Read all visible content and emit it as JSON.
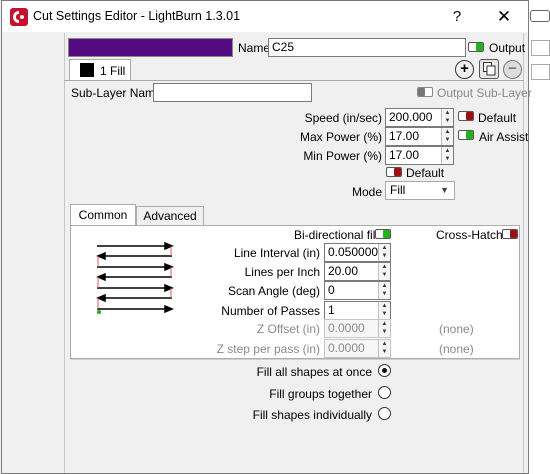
{
  "layer_list": {
    "selected_layer": "25"
  },
  "window": {
    "title": "Cut Settings Editor - LightBurn 1.3.01",
    "help_glyph": "?",
    "close_glyph": "✕"
  },
  "header": {
    "color": "#540b82",
    "name_label": "Name",
    "name_value": "C25",
    "output_label": "Output"
  },
  "sublayer": {
    "tab_label": "1 Fill",
    "name_label": "Sub-Layer Name",
    "name_value": "",
    "output_label": "Output Sub-Layer",
    "add_glyph": "+",
    "remove_glyph": "−"
  },
  "settings": {
    "speed_label": "Speed (in/sec)",
    "speed_value": "200.000",
    "speed_default_label": "Default",
    "max_power_label": "Max Power (%)",
    "max_power_value": "17.00",
    "air_assist_label": "Air Assist",
    "min_power_label": "Min Power (%)",
    "min_power_value": "17.00",
    "power_default_label": "Default",
    "mode_label": "Mode",
    "mode_value": "Fill"
  },
  "tabs": {
    "common": "Common",
    "advanced": "Advanced"
  },
  "fill": {
    "bidirectional_label": "Bi-directional fill",
    "crosshatch_label": "Cross-Hatch",
    "line_interval_label": "Line Interval (in)",
    "line_interval_value": "0.050000",
    "lines_per_inch_label": "Lines per Inch",
    "lines_per_inch_value": "20.00",
    "scan_angle_label": "Scan Angle (deg)",
    "scan_angle_value": "0",
    "passes_label": "Number of Passes",
    "passes_value": "1",
    "z_offset_label": "Z Offset (in)",
    "z_offset_value": "0.0000",
    "z_offset_note": "(none)",
    "z_step_label": "Z step per pass (in)",
    "z_step_value": "0.0000",
    "z_step_note": "(none)"
  },
  "fill_options": {
    "all_at_once": "Fill all shapes at once",
    "groups_together": "Fill groups together",
    "individually": "Fill shapes individually"
  }
}
